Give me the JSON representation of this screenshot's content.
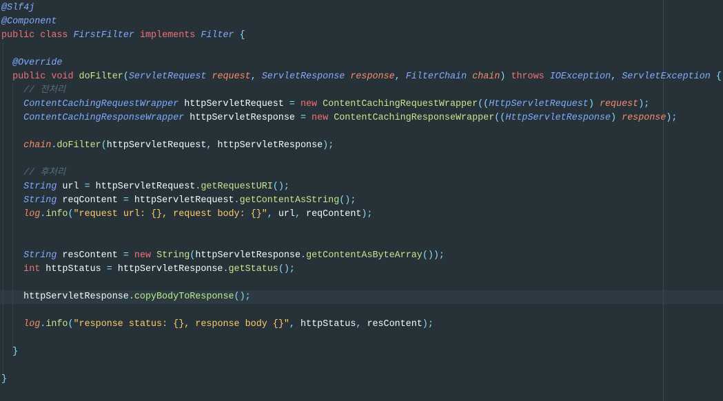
{
  "editor": {
    "lines": [
      {
        "tokens": [
          {
            "t": "@Slf4j",
            "c": "ann"
          }
        ]
      },
      {
        "tokens": [
          {
            "t": "@Component",
            "c": "ann"
          }
        ]
      },
      {
        "tokens": [
          {
            "t": "public",
            "c": "kw"
          },
          {
            "t": " ",
            "c": "id"
          },
          {
            "t": "class",
            "c": "kw"
          },
          {
            "t": " ",
            "c": "id"
          },
          {
            "t": "FirstFilter",
            "c": "ty"
          },
          {
            "t": " ",
            "c": "id"
          },
          {
            "t": "implements",
            "c": "kw"
          },
          {
            "t": " ",
            "c": "id"
          },
          {
            "t": "Filter",
            "c": "ty"
          },
          {
            "t": " {",
            "c": "pn"
          }
        ]
      },
      {
        "tokens": []
      },
      {
        "tokens": [
          {
            "t": "  @Override",
            "c": "ann"
          }
        ]
      },
      {
        "tokens": [
          {
            "t": "  ",
            "c": "id"
          },
          {
            "t": "public",
            "c": "kw"
          },
          {
            "t": " ",
            "c": "id"
          },
          {
            "t": "void",
            "c": "kw"
          },
          {
            "t": " ",
            "c": "id"
          },
          {
            "t": "doFilter",
            "c": "fn"
          },
          {
            "t": "(",
            "c": "pn"
          },
          {
            "t": "ServletRequest",
            "c": "ty"
          },
          {
            "t": " ",
            "c": "id"
          },
          {
            "t": "request",
            "c": "par"
          },
          {
            "t": ", ",
            "c": "pn"
          },
          {
            "t": "ServletResponse",
            "c": "ty"
          },
          {
            "t": " ",
            "c": "id"
          },
          {
            "t": "response",
            "c": "par"
          },
          {
            "t": ", ",
            "c": "pn"
          },
          {
            "t": "FilterChain",
            "c": "ty"
          },
          {
            "t": " ",
            "c": "id"
          },
          {
            "t": "chain",
            "c": "par"
          },
          {
            "t": ") ",
            "c": "pn"
          },
          {
            "t": "throws",
            "c": "kw"
          },
          {
            "t": " ",
            "c": "id"
          },
          {
            "t": "IOException",
            "c": "ty"
          },
          {
            "t": ", ",
            "c": "pn"
          },
          {
            "t": "ServletException",
            "c": "ty"
          },
          {
            "t": " {",
            "c": "pn"
          }
        ]
      },
      {
        "tokens": [
          {
            "t": "    // 전처리",
            "c": "cm"
          }
        ]
      },
      {
        "tokens": [
          {
            "t": "    ",
            "c": "id"
          },
          {
            "t": "ContentCachingRequestWrapper",
            "c": "ty"
          },
          {
            "t": " httpServletRequest ",
            "c": "id"
          },
          {
            "t": "=",
            "c": "pn"
          },
          {
            "t": " ",
            "c": "id"
          },
          {
            "t": "new",
            "c": "kw"
          },
          {
            "t": " ",
            "c": "id"
          },
          {
            "t": "ContentCachingRequestWrapper",
            "c": "fn"
          },
          {
            "t": "((",
            "c": "pn"
          },
          {
            "t": "HttpServletRequest",
            "c": "ty"
          },
          {
            "t": ") ",
            "c": "pn"
          },
          {
            "t": "request",
            "c": "par"
          },
          {
            "t": ");",
            "c": "pn"
          }
        ]
      },
      {
        "tokens": [
          {
            "t": "    ",
            "c": "id"
          },
          {
            "t": "ContentCachingResponseWrapper",
            "c": "ty"
          },
          {
            "t": " httpServletResponse ",
            "c": "id"
          },
          {
            "t": "=",
            "c": "pn"
          },
          {
            "t": " ",
            "c": "id"
          },
          {
            "t": "new",
            "c": "kw"
          },
          {
            "t": " ",
            "c": "id"
          },
          {
            "t": "ContentCachingResponseWrapper",
            "c": "fn"
          },
          {
            "t": "((",
            "c": "pn"
          },
          {
            "t": "HttpServletResponse",
            "c": "ty"
          },
          {
            "t": ") ",
            "c": "pn"
          },
          {
            "t": "response",
            "c": "par"
          },
          {
            "t": ");",
            "c": "pn"
          }
        ]
      },
      {
        "tokens": []
      },
      {
        "tokens": [
          {
            "t": "    ",
            "c": "id"
          },
          {
            "t": "chain",
            "c": "par"
          },
          {
            "t": ".",
            "c": "dot"
          },
          {
            "t": "doFilter",
            "c": "fn"
          },
          {
            "t": "(",
            "c": "pn"
          },
          {
            "t": "httpServletRequest",
            "c": "id"
          },
          {
            "t": ", ",
            "c": "pn"
          },
          {
            "t": "httpServletResponse",
            "c": "id"
          },
          {
            "t": ");",
            "c": "pn"
          }
        ]
      },
      {
        "tokens": []
      },
      {
        "tokens": [
          {
            "t": "    // 후처리",
            "c": "cm"
          }
        ]
      },
      {
        "tokens": [
          {
            "t": "    ",
            "c": "id"
          },
          {
            "t": "String",
            "c": "ty"
          },
          {
            "t": " url ",
            "c": "id"
          },
          {
            "t": "=",
            "c": "pn"
          },
          {
            "t": " httpServletRequest",
            "c": "id"
          },
          {
            "t": ".",
            "c": "dot"
          },
          {
            "t": "getRequestURI",
            "c": "fn"
          },
          {
            "t": "();",
            "c": "pn"
          }
        ]
      },
      {
        "tokens": [
          {
            "t": "    ",
            "c": "id"
          },
          {
            "t": "String",
            "c": "ty"
          },
          {
            "t": " reqContent ",
            "c": "id"
          },
          {
            "t": "=",
            "c": "pn"
          },
          {
            "t": " httpServletRequest",
            "c": "id"
          },
          {
            "t": ".",
            "c": "dot"
          },
          {
            "t": "getContentAsString",
            "c": "fn"
          },
          {
            "t": "();",
            "c": "pn"
          }
        ]
      },
      {
        "tokens": [
          {
            "t": "    ",
            "c": "id"
          },
          {
            "t": "log",
            "c": "fld"
          },
          {
            "t": ".",
            "c": "dot"
          },
          {
            "t": "info",
            "c": "fn"
          },
          {
            "t": "(",
            "c": "pn"
          },
          {
            "t": "\"request url: {}, request body: {}\"",
            "c": "str"
          },
          {
            "t": ", ",
            "c": "pn"
          },
          {
            "t": "url",
            "c": "id"
          },
          {
            "t": ", ",
            "c": "pn"
          },
          {
            "t": "reqContent",
            "c": "id"
          },
          {
            "t": ");",
            "c": "pn"
          }
        ]
      },
      {
        "tokens": []
      },
      {
        "tokens": []
      },
      {
        "tokens": [
          {
            "t": "    ",
            "c": "id"
          },
          {
            "t": "String",
            "c": "ty"
          },
          {
            "t": " resContent ",
            "c": "id"
          },
          {
            "t": "=",
            "c": "pn"
          },
          {
            "t": " ",
            "c": "id"
          },
          {
            "t": "new",
            "c": "kw"
          },
          {
            "t": " ",
            "c": "id"
          },
          {
            "t": "String",
            "c": "fn"
          },
          {
            "t": "(",
            "c": "pn"
          },
          {
            "t": "httpServletResponse",
            "c": "id"
          },
          {
            "t": ".",
            "c": "dot"
          },
          {
            "t": "getContentAsByteArray",
            "c": "fn"
          },
          {
            "t": "());",
            "c": "pn"
          }
        ]
      },
      {
        "tokens": [
          {
            "t": "    ",
            "c": "id"
          },
          {
            "t": "int",
            "c": "kw"
          },
          {
            "t": " httpStatus ",
            "c": "id"
          },
          {
            "t": "=",
            "c": "pn"
          },
          {
            "t": " httpServletResponse",
            "c": "id"
          },
          {
            "t": ".",
            "c": "dot"
          },
          {
            "t": "getStatus",
            "c": "fn"
          },
          {
            "t": "();",
            "c": "pn"
          }
        ]
      },
      {
        "tokens": []
      },
      {
        "tokens": [
          {
            "t": "    httpServletResponse",
            "c": "id"
          },
          {
            "t": ".",
            "c": "dot"
          },
          {
            "t": "copyBodyToResponse",
            "c": "fn"
          },
          {
            "t": "();",
            "c": "pn"
          }
        ]
      },
      {
        "tokens": []
      },
      {
        "tokens": [
          {
            "t": "    ",
            "c": "id"
          },
          {
            "t": "log",
            "c": "fld"
          },
          {
            "t": ".",
            "c": "dot"
          },
          {
            "t": "info",
            "c": "fn"
          },
          {
            "t": "(",
            "c": "pn"
          },
          {
            "t": "\"response status: {}, response body {}\"",
            "c": "str"
          },
          {
            "t": ", ",
            "c": "pn"
          },
          {
            "t": "httpStatus",
            "c": "id"
          },
          {
            "t": ", ",
            "c": "pn"
          },
          {
            "t": "resContent",
            "c": "id"
          },
          {
            "t": ");",
            "c": "pn"
          }
        ]
      },
      {
        "tokens": []
      },
      {
        "tokens": [
          {
            "t": "  }",
            "c": "pn"
          }
        ]
      },
      {
        "tokens": []
      },
      {
        "tokens": [
          {
            "t": "}",
            "c": "pn"
          }
        ]
      }
    ],
    "current_line": 21
  },
  "colors": {
    "background": "#263238",
    "current_line": "#2c3b41",
    "keyword": "#f07178",
    "type": "#82aaff",
    "function": "#c3e88d",
    "string": "#ffcb6b",
    "parameter": "#f78c6c",
    "comment": "#546e7a",
    "punctuation": "#89ddff",
    "identifier": "#eeffff"
  }
}
